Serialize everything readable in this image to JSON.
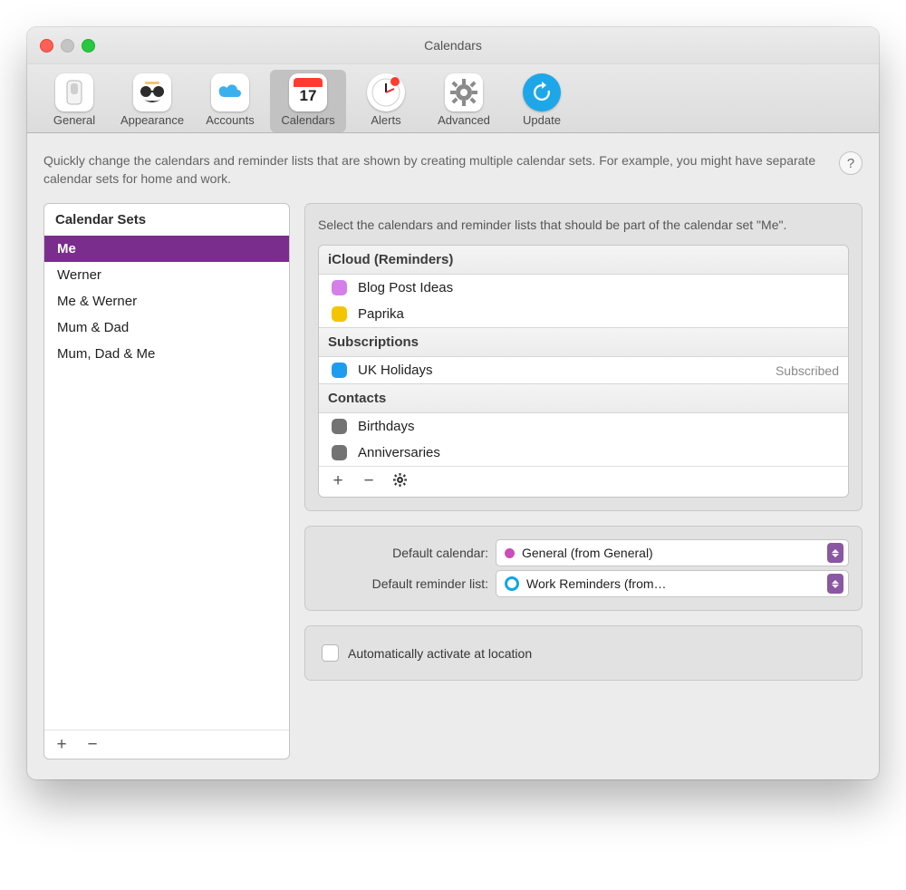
{
  "window": {
    "title": "Calendars"
  },
  "toolbar": {
    "items": [
      {
        "id": "general",
        "label": "General"
      },
      {
        "id": "appearance",
        "label": "Appearance"
      },
      {
        "id": "accounts",
        "label": "Accounts"
      },
      {
        "id": "calendars",
        "label": "Calendars",
        "selected": true,
        "day": "17"
      },
      {
        "id": "alerts",
        "label": "Alerts"
      },
      {
        "id": "advanced",
        "label": "Advanced"
      },
      {
        "id": "update",
        "label": "Update"
      }
    ]
  },
  "intro": "Quickly change the calendars and reminder lists that are shown by creating multiple calendar sets. For example, you might have separate calendar sets for home and work.",
  "help_glyph": "?",
  "sets_panel": {
    "header": "Calendar Sets",
    "items": [
      {
        "name": "Me",
        "selected": true
      },
      {
        "name": "Werner"
      },
      {
        "name": "Me & Werner"
      },
      {
        "name": "Mum & Dad"
      },
      {
        "name": "Mum, Dad & Me"
      }
    ],
    "plus": "+",
    "minus": "−"
  },
  "detail": {
    "intro": "Select the calendars and reminder lists that should be part of the calendar set \"Me\".",
    "sections": [
      {
        "title": "iCloud (Reminders)",
        "items": [
          {
            "name": "Blog Post Ideas",
            "color": "#d480e8"
          },
          {
            "name": "Paprika",
            "color": "#f5c400"
          }
        ]
      },
      {
        "title": "Subscriptions",
        "items": [
          {
            "name": "UK Holidays",
            "color": "#1e9cf0",
            "tag": "Subscribed"
          }
        ]
      },
      {
        "title": "Contacts",
        "items": [
          {
            "name": "Birthdays",
            "color": "#737373"
          },
          {
            "name": "Anniversaries",
            "color": "#737373"
          }
        ]
      }
    ],
    "foot": {
      "plus": "+",
      "minus": "−",
      "gear": "✱"
    }
  },
  "defaults": {
    "calendar_lbl": "Default calendar:",
    "calendar_val": "General (from General)",
    "calendar_color": "#c94dbb",
    "reminder_lbl": "Default reminder list:",
    "reminder_val": "Work Reminders (from…",
    "reminder_color": "#0ea7e8"
  },
  "location": {
    "label": "Automatically activate at location",
    "checked": false
  }
}
